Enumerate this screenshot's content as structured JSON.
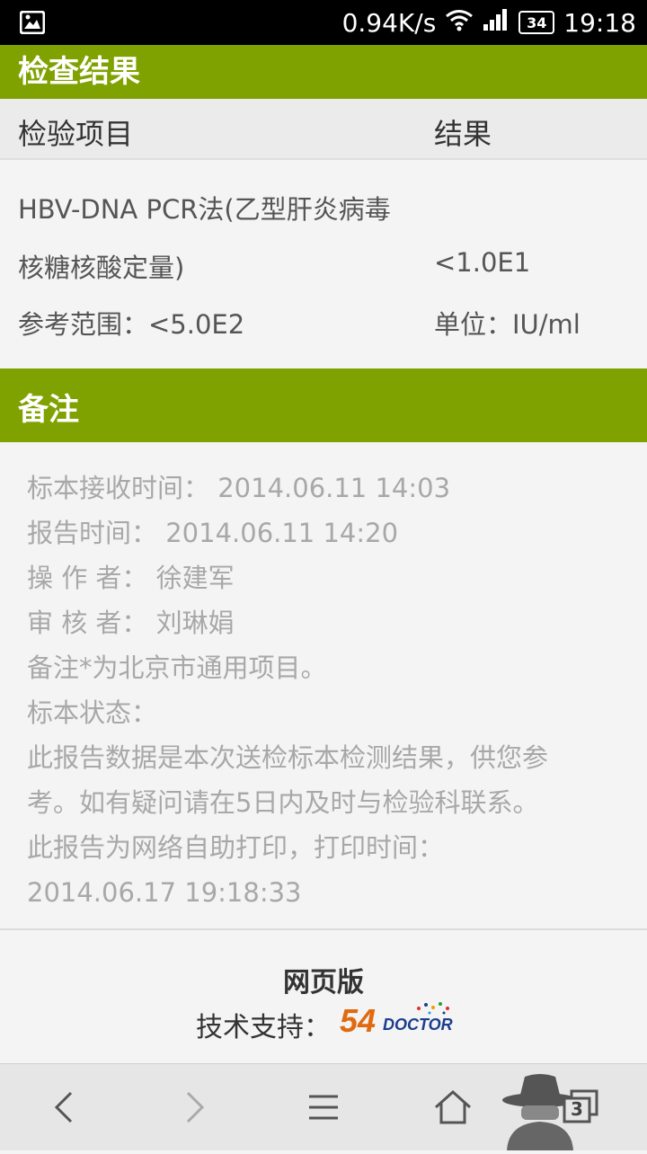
{
  "status_bar": {
    "net_speed": "0.94K/s",
    "battery_level": "34",
    "time": "19:18",
    "icons": [
      "gallery-icon",
      "wifi-icon",
      "signal-icon",
      "battery-icon"
    ]
  },
  "results_section": {
    "title": "检查结果",
    "column_item": "检验项目",
    "column_result": "结果",
    "test_name_line1": "HBV-DNA PCR法(乙型肝炎病毒",
    "test_name_line2": "核糖核酸定量)",
    "result_value": "<1.0E1",
    "reference_range": "参考范围：<5.0E2",
    "unit": "单位：IU/ml"
  },
  "remarks_section": {
    "title": "备注",
    "lines": [
      "标本接收时间： 2014.06.11 14:03",
      "报告时间： 2014.06.11 14:20",
      "操 作 者： 徐建军",
      "审 核 者： 刘琳娟",
      "备注*为北京市通用项目。",
      "标本状态：",
      "此报告数据是本次送检标本检测结果，供您参",
      "考。如有疑问请在5日内及时与检验科联系。",
      "此报告为网络自助打印，打印时间：",
      "2014.06.17 19:18:33"
    ]
  },
  "footer": {
    "web_version": "网页版",
    "tech_support": "技术支持：",
    "logo_text": "54DOCTOR"
  },
  "nav_bar": {
    "tab_count": "3",
    "icons": [
      "back-icon",
      "forward-icon",
      "menu-icon",
      "home-icon",
      "incognito-icon",
      "tabs-icon"
    ]
  },
  "colors": {
    "header_green": "#80a200",
    "logo_orange": "#e06a10",
    "logo_blue": "#1a3e8c"
  }
}
